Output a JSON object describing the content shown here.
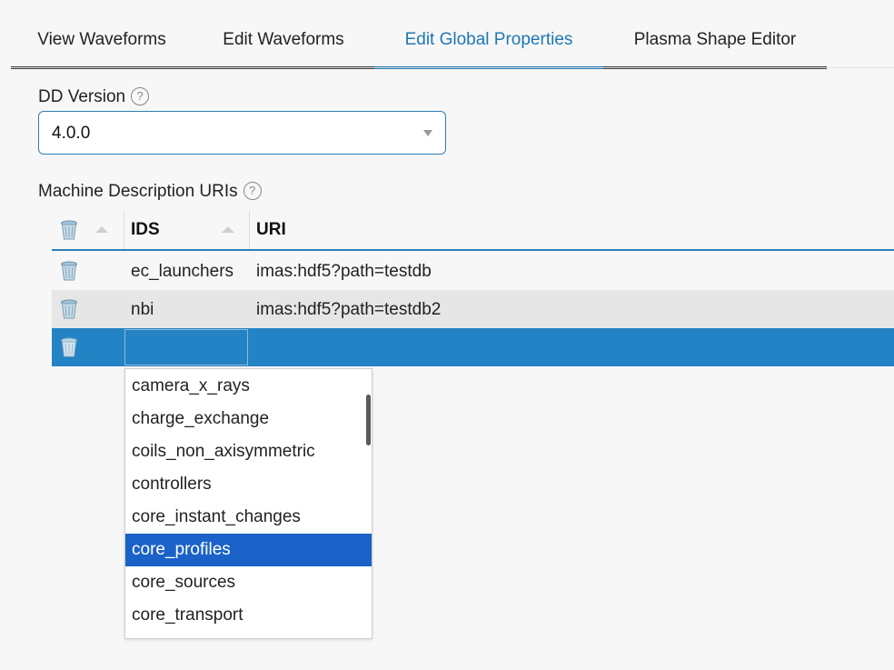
{
  "tabs": [
    {
      "label": "View Waveforms",
      "active": false
    },
    {
      "label": "Edit Waveforms",
      "active": false
    },
    {
      "label": "Edit Global Properties",
      "active": true
    },
    {
      "label": "Plasma Shape Editor",
      "active": false
    }
  ],
  "dd_version": {
    "label": "DD Version",
    "value": "4.0.0",
    "help_icon": "question-circle-icon"
  },
  "machine_description": {
    "label": "Machine Description URIs",
    "help_icon": "question-circle-icon"
  },
  "grid": {
    "columns": [
      "IDS",
      "URI"
    ],
    "rows": [
      {
        "ids": "ec_launchers",
        "uri": "imas:hdf5?path=testdb",
        "state": "normal"
      },
      {
        "ids": "nbi",
        "uri": "imas:hdf5?path=testdb2",
        "state": "alternate"
      },
      {
        "ids": "",
        "uri": "",
        "state": "selected-editing"
      }
    ],
    "delete_icon": "trash-icon"
  },
  "ids_dropdown": {
    "options": [
      "camera_x_rays",
      "charge_exchange",
      "coils_non_axisymmetric",
      "controllers",
      "core_instant_changes",
      "core_profiles",
      "core_sources",
      "core_transport"
    ],
    "highlighted": "core_profiles"
  },
  "colors": {
    "accent": "#1f77b4",
    "selected_row": "#2483c5",
    "highlight_option": "#1a62c8"
  }
}
